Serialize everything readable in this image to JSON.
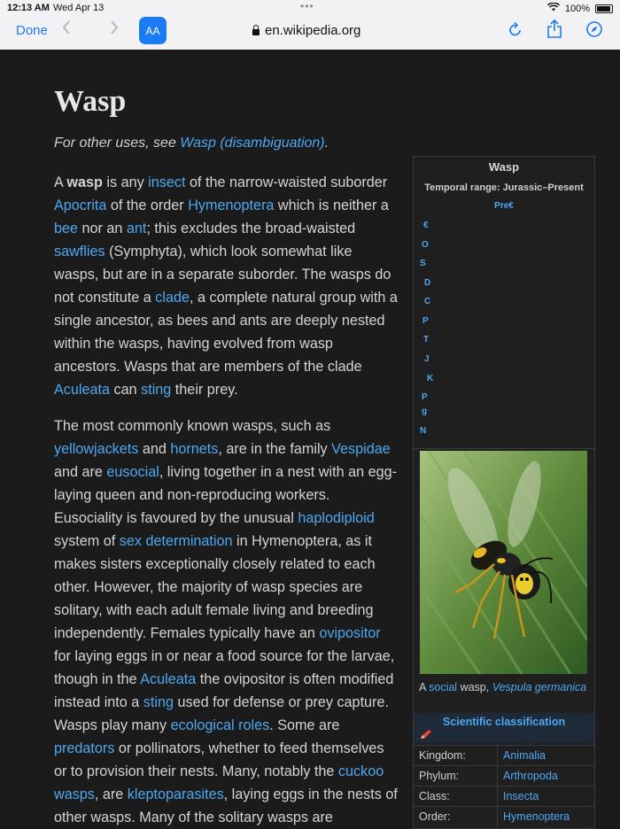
{
  "status": {
    "time": "12:13 AM",
    "date": "Wed Apr 13",
    "battery": "100%"
  },
  "toolbar": {
    "done": "Done",
    "reader": "AA",
    "url": "en.wikipedia.org",
    "back_icon": "chevron-left-icon",
    "forward_icon": "chevron-right-icon",
    "reload_icon": "reload-icon",
    "share_icon": "share-icon",
    "compass_icon": "compass-icon"
  },
  "article": {
    "title": "Wasp",
    "hatnote_prefix": "For other uses, see ",
    "hatnote_link": "Wasp (disambiguation)",
    "hatnote_suffix": "."
  },
  "p1": {
    "t0": "A ",
    "b0": "wasp",
    "t1": " is any ",
    "l_insect": "insect",
    "t2": " of the narrow-waisted suborder ",
    "l_apocrita": "Apocrita",
    "t3": " of the order ",
    "l_hymenoptera": "Hymenoptera",
    "t4": " which is neither a ",
    "l_bee": "bee",
    "t5": " nor an ",
    "l_ant": "ant",
    "t6": "; this excludes the broad-waisted ",
    "l_sawflies": "sawflies",
    "t7": " (Symphyta), which look somewhat like wasps, but are in a separate suborder. The wasps do not constitute a ",
    "l_clade": "clade",
    "t8": ", a complete natural group with a single ancestor, as bees and ants are deeply nested within the wasps, having evolved from wasp ancestors. Wasps that are members of the clade ",
    "l_aculeata": "Aculeata",
    "t9": " can ",
    "l_sting": "sting",
    "t10": " their prey."
  },
  "p2": {
    "t0": "The most commonly known wasps, such as ",
    "l_yellowjackets": "yellowjackets",
    "t1": " and ",
    "l_hornets": "hornets",
    "t2": ", are in the family ",
    "l_vespidae": "Vespidae",
    "t3": " and are ",
    "l_eusocial": "eusocial",
    "t4": ", living together in a nest with an egg-laying queen and non-reproducing workers. Eusociality is favoured by the unusual ",
    "l_haplodiploid": "haplodiploid",
    "t5": " system of ",
    "l_sexdet": "sex determination",
    "t6": " in Hymenoptera, as it makes sisters exceptionally closely related to each other. However, the majority of wasp species are solitary, with each adult female living and breeding independently. Females typically have an ",
    "l_ovipositor": "ovipositor",
    "t7": " for laying eggs in or near a food source for the larvae, though in the ",
    "l_aculeata": "Aculeata",
    "t8": " the ovipositor is often modified instead into a ",
    "l_sting": "sting",
    "t9": " used for defense or prey capture. Wasps play many ",
    "l_ecological": "ecological roles",
    "t10": ". Some are ",
    "l_predators": "predators",
    "t11": " or pollinators, whether to feed themselves or to provision their nests. Many, notably the ",
    "l_cuckoo": "cuckoo wasps",
    "t12": ", are ",
    "l_klepto": "kleptoparasites",
    "t13": ", laying eggs in the nests of other wasps. Many of the solitary wasps are"
  },
  "infobox": {
    "title": "Wasp",
    "range": "Temporal range: Jurassic–Present",
    "prec": "Pre€",
    "eras": [
      "€",
      "O",
      "S",
      "D",
      "C",
      "P",
      "T",
      "J",
      "K",
      "P",
      "g",
      "N"
    ],
    "caption_prefix": "A ",
    "caption_link": "social",
    "caption_mid": " wasp, ",
    "caption_species": "Vespula germanica",
    "sci_title": "Scientific classification",
    "taxonomy": [
      {
        "rank": "Kingdom:",
        "value": "Animalia"
      },
      {
        "rank": "Phylum:",
        "value": "Arthropoda"
      },
      {
        "rank": "Class:",
        "value": "Insecta"
      },
      {
        "rank": "Order:",
        "value": "Hymenoptera"
      }
    ]
  }
}
